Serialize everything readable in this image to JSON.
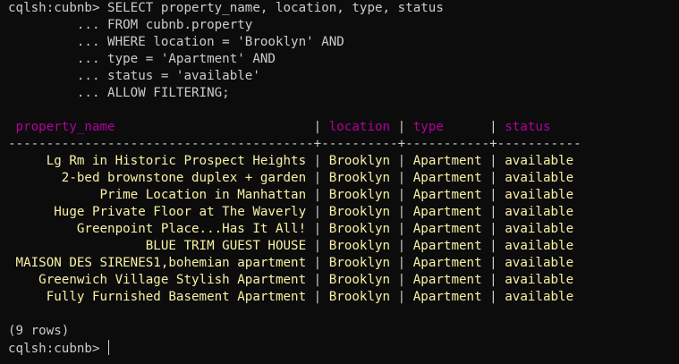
{
  "prompt": "cqlsh:cubnb>",
  "query_lines": [
    "SELECT property_name, location, type, status",
    "... FROM cubnb.property",
    "... WHERE location = 'Brooklyn' AND",
    "... type = 'Apartment' AND",
    "... status = 'available'",
    "... ALLOW FILTERING;"
  ],
  "columns": [
    "property_name",
    "location",
    "type",
    "status"
  ],
  "divider": "----------------------------------------+----------+-----------+-----------",
  "rows": [
    [
      "Lg Rm in Historic Prospect Heights",
      "Brooklyn",
      "Apartment",
      "available"
    ],
    [
      "2-bed brownstone duplex + garden",
      "Brooklyn",
      "Apartment",
      "available"
    ],
    [
      "Prime Location in Manhattan",
      "Brooklyn",
      "Apartment",
      "available"
    ],
    [
      "Huge Private Floor at The Waverly",
      "Brooklyn",
      "Apartment",
      "available"
    ],
    [
      "Greenpoint Place...Has It All!",
      "Brooklyn",
      "Apartment",
      "available"
    ],
    [
      "BLUE TRIM GUEST HOUSE",
      "Brooklyn",
      "Apartment",
      "available"
    ],
    [
      "MAISON DES SIRENES1,bohemian apartment",
      "Brooklyn",
      "Apartment",
      "available"
    ],
    [
      "Greenwich Village Stylish Apartment",
      "Brooklyn",
      "Apartment",
      "available"
    ],
    [
      "Fully Furnished Basement Apartment",
      "Brooklyn",
      "Apartment",
      "available"
    ]
  ],
  "row_count": "(9 rows)",
  "colors": {
    "background": "#0c0c0c",
    "text": "#cccccc",
    "header": "#b4009e",
    "value": "#f9f1a5"
  }
}
